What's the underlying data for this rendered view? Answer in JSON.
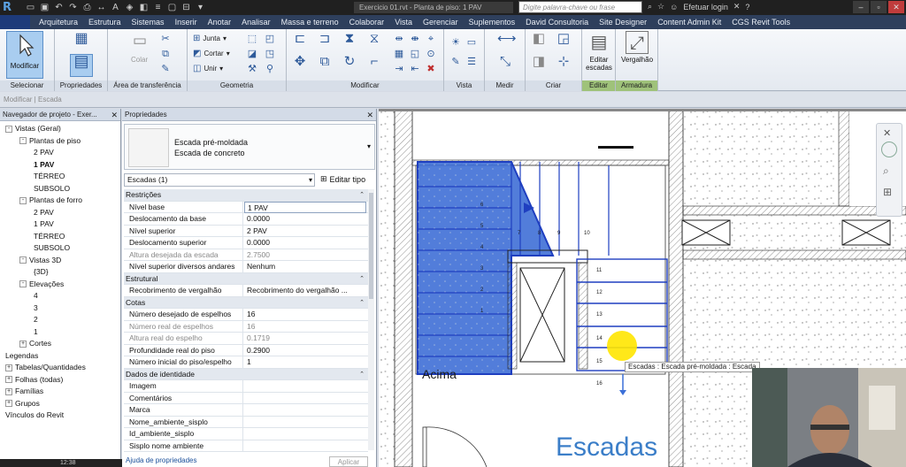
{
  "app": {
    "logo_letter": "R",
    "document_title": "Exercicio 01.rvt - Planta de piso: 1 PAV",
    "search_placeholder": "Digite palavra-chave ou frase",
    "login_label": "Efetuar login"
  },
  "menu": {
    "tabs": [
      "Arquitetura",
      "Estrutura",
      "Sistemas",
      "Inserir",
      "Anotar",
      "Analisar",
      "Massa e terreno",
      "Colaborar",
      "Vista",
      "Gerenciar",
      "Suplementos",
      "David Consultoria",
      "Site Designer",
      "Content Admin Kit",
      "CGS Revit Tools"
    ]
  },
  "ribbon": {
    "modify_label": "Modificar",
    "panels": {
      "select": "Selecionar",
      "properties": "Propriedades",
      "clipboard": "Área de transferência",
      "geometry": "Geometria",
      "modify": "Modificar",
      "view": "Vista",
      "measure": "Medir",
      "create": "Criar",
      "edit": "Editar",
      "rebar": "Armadura"
    },
    "paste_label": "Colar",
    "geometry_buttons": {
      "join": "Junta",
      "cut": "Cortar",
      "unite": "Unir"
    },
    "edit_stairs_line1": "Editar",
    "edit_stairs_line2": "escadas",
    "rebar_label": "Vergalhão"
  },
  "options_bar": {
    "text": "Modificar | Escada"
  },
  "project_browser": {
    "title": "Navegador de projeto - Exer...",
    "items": [
      {
        "label": "Vistas (Geral)",
        "level": 0,
        "exp": "-",
        "bold": false
      },
      {
        "label": "Plantas de piso",
        "level": 1,
        "exp": "-",
        "bold": false
      },
      {
        "label": "2 PAV",
        "level": 2,
        "exp": "",
        "bold": false
      },
      {
        "label": "1 PAV",
        "level": 2,
        "exp": "",
        "bold": true
      },
      {
        "label": "TÉRREO",
        "level": 2,
        "exp": "",
        "bold": false
      },
      {
        "label": "SUBSOLO",
        "level": 2,
        "exp": "",
        "bold": false
      },
      {
        "label": "Plantas de forro",
        "level": 1,
        "exp": "-",
        "bold": false
      },
      {
        "label": "2 PAV",
        "level": 2,
        "exp": "",
        "bold": false
      },
      {
        "label": "1 PAV",
        "level": 2,
        "exp": "",
        "bold": false
      },
      {
        "label": "TÉRREO",
        "level": 2,
        "exp": "",
        "bold": false
      },
      {
        "label": "SUBSOLO",
        "level": 2,
        "exp": "",
        "bold": false
      },
      {
        "label": "Vistas 3D",
        "level": 1,
        "exp": "-",
        "bold": false
      },
      {
        "label": "{3D}",
        "level": 2,
        "exp": "",
        "bold": false
      },
      {
        "label": "Elevações",
        "level": 1,
        "exp": "-",
        "bold": false
      },
      {
        "label": "4",
        "level": 2,
        "exp": "",
        "bold": false
      },
      {
        "label": "3",
        "level": 2,
        "exp": "",
        "bold": false
      },
      {
        "label": "2",
        "level": 2,
        "exp": "",
        "bold": false
      },
      {
        "label": "1",
        "level": 2,
        "exp": "",
        "bold": false
      },
      {
        "label": "Cortes",
        "level": 1,
        "exp": "+",
        "bold": false
      },
      {
        "label": "Legendas",
        "level": 0,
        "exp": "",
        "bold": false
      },
      {
        "label": "Tabelas/Quantidades",
        "level": 0,
        "exp": "+",
        "bold": false
      },
      {
        "label": "Folhas (todas)",
        "level": 0,
        "exp": "+",
        "bold": false
      },
      {
        "label": "Famílias",
        "level": 0,
        "exp": "+",
        "bold": false
      },
      {
        "label": "Grupos",
        "level": 0,
        "exp": "+",
        "bold": false
      },
      {
        "label": "Vínculos do Revit",
        "level": 0,
        "exp": "",
        "bold": false
      }
    ]
  },
  "properties": {
    "title": "Propriedades",
    "type_family": "Escada pré-moldada",
    "type_name": "Escada de concreto",
    "instance_selector": "Escadas (1)",
    "edit_type_label": "Editar tipo",
    "rows": [
      {
        "section": true,
        "key": "Restrições"
      },
      {
        "key": "Nível base",
        "value": "1 PAV",
        "boxed": true
      },
      {
        "key": "Deslocamento da base",
        "value": "0.0000"
      },
      {
        "key": "Nível superior",
        "value": "2 PAV"
      },
      {
        "key": "Deslocamento superior",
        "value": "0.0000"
      },
      {
        "key": "Altura desejada da escada",
        "value": "2.7500",
        "gray": true
      },
      {
        "key": "Nível superior diversos andares",
        "value": "Nenhum"
      },
      {
        "section": true,
        "key": "Estrutural"
      },
      {
        "key": "Recobrimento de vergalhão",
        "value": "Recobrimento do vergalhão ..."
      },
      {
        "section": true,
        "key": "Cotas"
      },
      {
        "key": "Número desejado de espelhos",
        "value": "16"
      },
      {
        "key": "Número real de espelhos",
        "value": "16",
        "gray": true
      },
      {
        "key": "Altura real do espelho",
        "value": "0.1719",
        "gray": true
      },
      {
        "key": "Profundidade real do piso",
        "value": "0.2900"
      },
      {
        "key": "Número inicial do piso/espelho",
        "value": "1"
      },
      {
        "section": true,
        "key": "Dados de identidade"
      },
      {
        "key": "Imagem",
        "value": ""
      },
      {
        "key": "Comentários",
        "value": ""
      },
      {
        "key": "Marca",
        "value": ""
      },
      {
        "key": "Nome_ambiente_sisplo",
        "value": ""
      },
      {
        "key": "Id_ambiente_sisplo",
        "value": ""
      },
      {
        "key": "Sisplo nome ambiente",
        "value": ""
      }
    ],
    "help_link": "Ajuda de propriedades",
    "apply_label": "Aplicar"
  },
  "canvas": {
    "up_label": "Acima",
    "view_title": "Escadas",
    "tooltip": "Escadas : Escada pré-moldada : Escada",
    "step_numbers": [
      "1",
      "2",
      "3",
      "4",
      "5",
      "6",
      "7",
      "8",
      "9",
      "10",
      "11",
      "12",
      "13",
      "14",
      "15",
      "16"
    ],
    "stair_color": "#3f6fd6",
    "selection_color": "#1f3fc0"
  },
  "statusbar": {
    "time": "12:38"
  }
}
